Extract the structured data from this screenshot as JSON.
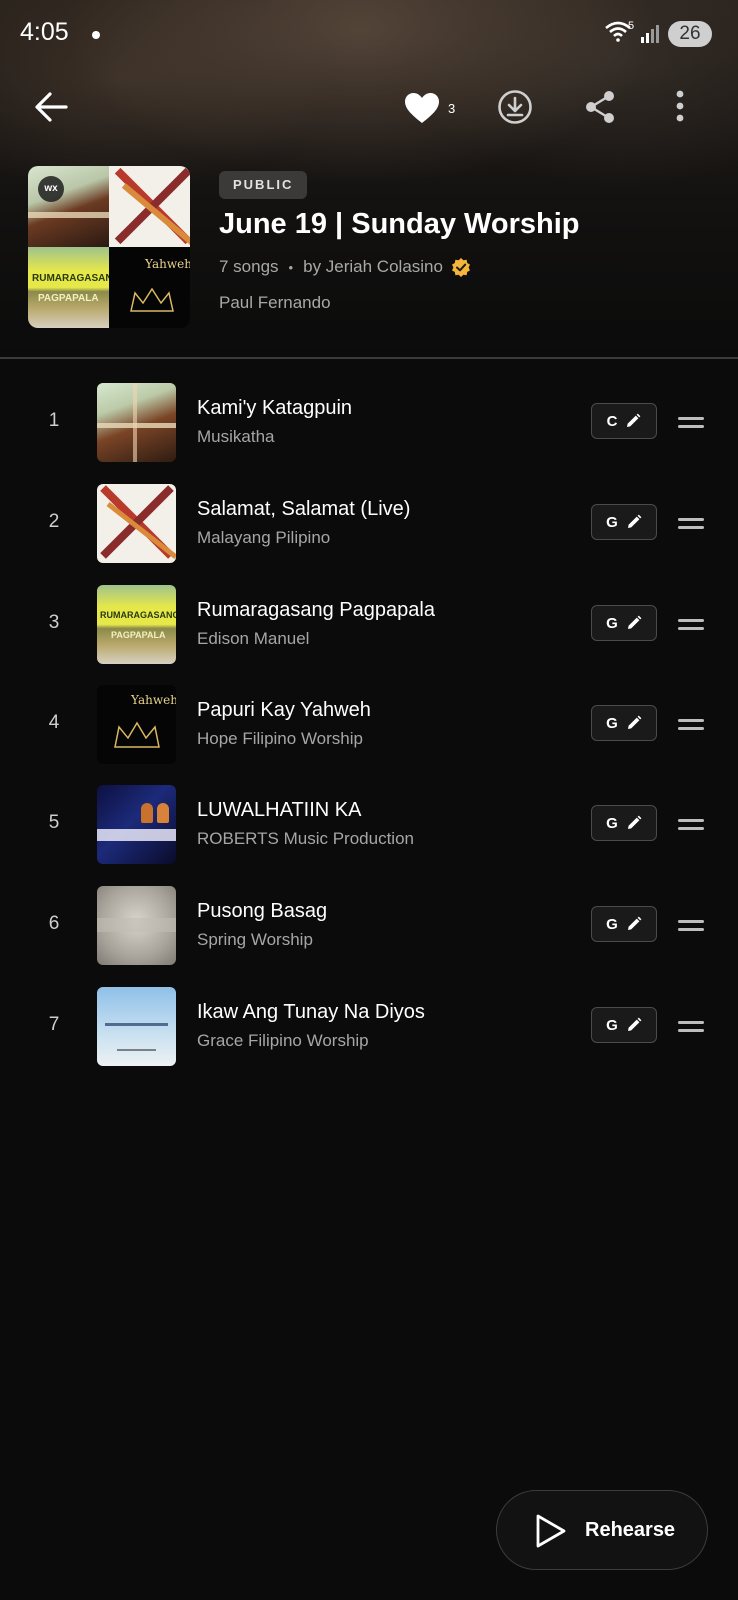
{
  "status_bar": {
    "time": "4:05",
    "wifi_label": "5",
    "battery": "26"
  },
  "toolbar": {
    "like_count": "3"
  },
  "playlist": {
    "badge": "PUBLIC",
    "title": "June 19 | Sunday Worship",
    "song_count": "7 songs",
    "separator": "•",
    "author": "by Jeriah Colasino",
    "collaborator": "Paul Fernando",
    "cover_logo": "wx"
  },
  "songs": [
    {
      "number": "1",
      "title": "Kami'y Katagpuin",
      "artist": "Musikatha",
      "key": "C"
    },
    {
      "number": "2",
      "title": "Salamat, Salamat (Live)",
      "artist": "Malayang Pilipino",
      "key": "G"
    },
    {
      "number": "3",
      "title": "Rumaragasang Pagpapala",
      "artist": "Edison Manuel",
      "key": "G"
    },
    {
      "number": "4",
      "title": "Papuri Kay Yahweh",
      "artist": "Hope Filipino Worship",
      "key": "G"
    },
    {
      "number": "5",
      "title": "LUWALHATIIN KA",
      "artist": "ROBERTS Music Production",
      "key": "G"
    },
    {
      "number": "6",
      "title": "Pusong Basag",
      "artist": "Spring Worship",
      "key": "G"
    },
    {
      "number": "7",
      "title": "Ikaw Ang Tunay Na Diyos",
      "artist": "Grace Filipino Worship",
      "key": "G"
    }
  ],
  "rehearse": {
    "label": "Rehearse"
  },
  "colors": {
    "background": "#0b0b0b",
    "verified": "#f5b53a",
    "badge_bg": "#3b3a38"
  }
}
